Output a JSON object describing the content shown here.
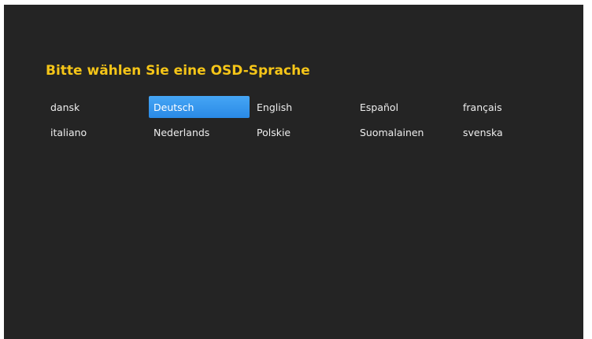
{
  "screen": {
    "title": "Bitte wählen Sie eine OSD-Sprache"
  },
  "languages": [
    {
      "label": "dansk",
      "selected": false
    },
    {
      "label": "Deutsch",
      "selected": true
    },
    {
      "label": "English",
      "selected": false
    },
    {
      "label": "Español",
      "selected": false
    },
    {
      "label": "français",
      "selected": false
    },
    {
      "label": "italiano",
      "selected": false
    },
    {
      "label": "Nederlands",
      "selected": false
    },
    {
      "label": "Polskie",
      "selected": false
    },
    {
      "label": "Suomalainen",
      "selected": false
    },
    {
      "label": "svenska",
      "selected": false
    }
  ],
  "colors": {
    "background": "#242424",
    "title": "#f5c518",
    "selection": "#2f90ea",
    "text": "#eeeeee"
  }
}
